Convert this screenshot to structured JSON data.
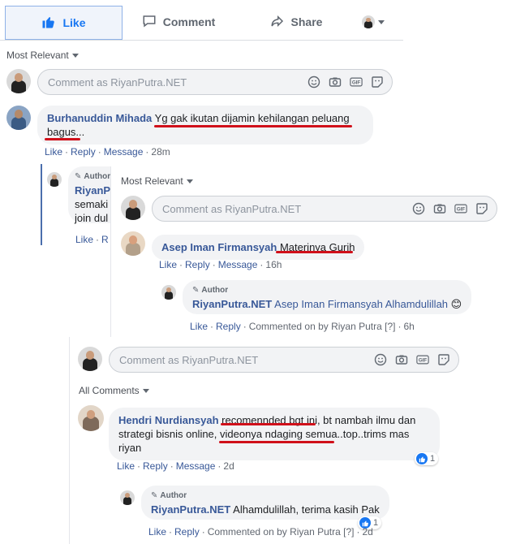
{
  "actions": {
    "like": "Like",
    "comment": "Comment",
    "share": "Share"
  },
  "panel1": {
    "sort": "Most Relevant",
    "composer_placeholder": "Comment as RiyanPutra.NET",
    "comment": {
      "author": "Burhanuddin Mihada",
      "text": "Yg gak ikutan dijamin kehilangan peluang bagus...",
      "like": "Like",
      "reply": "Reply",
      "message": "Message",
      "time": "28m"
    },
    "reply_partial": {
      "author_badge": "Author",
      "name": "RiyanP",
      "line1": "semaki",
      "line2": "join dul",
      "like": "Like",
      "reply": "R"
    }
  },
  "panel2": {
    "sort": "Most Relevant",
    "composer_placeholder": "Comment as RiyanPutra.NET",
    "comment": {
      "author": "Asep Iman Firmansyah",
      "text": "Materinya Gurih",
      "like": "Like",
      "reply": "Reply",
      "message": "Message",
      "time": "16h"
    },
    "reply": {
      "author_badge": "Author",
      "name": "RiyanPutra.NET",
      "text": "Asep Iman Firmansyah Alhamdulillah",
      "emoji": "😊",
      "like": "Like",
      "reply": "Reply",
      "commented_on": "Commented on by Riyan Putra",
      "q": "[?]",
      "time": "6h"
    }
  },
  "panel3": {
    "composer_placeholder": "Comment as RiyanPutra.NET",
    "sort": "All Comments",
    "comment": {
      "author": "Hendri Nurdiansyah",
      "text_line1": "recomennded bgt ini, bt nambah ilmu dan",
      "text_line2": "strategi bisnis online, videonya ndaging semua..top..trims mas",
      "text_line3": "riyan",
      "like": "Like",
      "reply": "Reply",
      "message": "Message",
      "time": "2d",
      "reactions": "1"
    },
    "reply": {
      "author_badge": "Author",
      "name": "RiyanPutra.NET",
      "text": "Alhamdulillah, terima kasih Pak",
      "like": "Like",
      "reply": "Reply",
      "commented_on": "Commented on by Riyan Putra",
      "q": "[?]",
      "time": "2d",
      "reactions": "1"
    }
  },
  "colors": {
    "link": "#385898",
    "underline": "#d0101a",
    "fb_blue": "#1877f2"
  }
}
